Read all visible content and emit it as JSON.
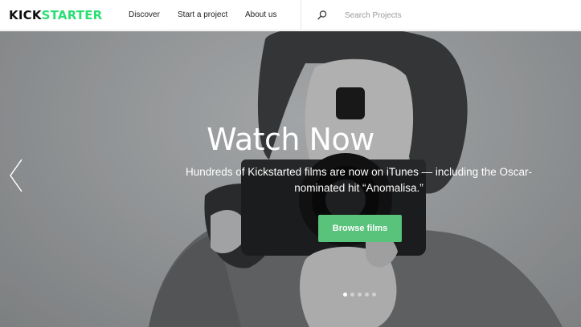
{
  "header": {
    "logo": {
      "part1": "KICK",
      "part2": "STARTER"
    },
    "nav": [
      "Discover",
      "Start a project",
      "About us"
    ],
    "search": {
      "placeholder": "Search Projects",
      "icon": "search-icon"
    }
  },
  "hero": {
    "title": "Watch Now",
    "subtitle": "Hundreds of Kickstarted films are now on iTunes — including the Oscar-nominated hit “Anomalisa.”",
    "button_label": "Browse films",
    "carousel": {
      "slides": 5,
      "active_index": 0
    }
  },
  "colors": {
    "brand_green": "#2bde73",
    "button_green": "#59c37b",
    "logo_dark": "#0f0f0f"
  }
}
